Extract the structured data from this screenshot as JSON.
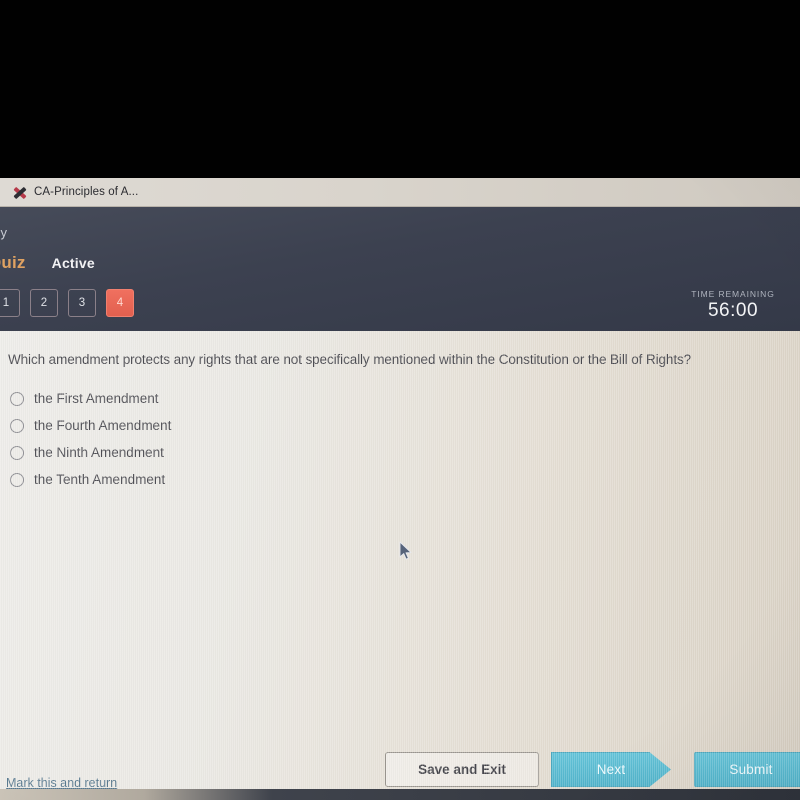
{
  "browser": {
    "tab": {
      "favicon": "x-mark-icon",
      "title": "CA-Principles of A..."
    }
  },
  "header": {
    "breadcrumb_clipped": "cy",
    "quiz_label": "Quiz",
    "status_label": "Active",
    "question_nav": [
      {
        "label": "1",
        "active": false
      },
      {
        "label": "2",
        "active": false
      },
      {
        "label": "3",
        "active": false
      },
      {
        "label": "4",
        "active": true
      }
    ],
    "timer": {
      "label": "TIME REMAINING",
      "value": "56:00"
    },
    "colors": {
      "header_bg": "#3c4150",
      "quiz_accent": "#e0a262",
      "active_tab": "#e2604f"
    }
  },
  "main": {
    "question": "Which amendment protects any rights that are not specifically mentioned within the Constitution or the Bill of Rights?",
    "options": [
      {
        "label": "the First Amendment",
        "selected": false
      },
      {
        "label": "the Fourth Amendment",
        "selected": false
      },
      {
        "label": "the Ninth Amendment",
        "selected": false
      },
      {
        "label": "the Tenth Amendment",
        "selected": false
      }
    ]
  },
  "footer": {
    "mark_return_label": "Mark this and return",
    "save_label": "Save and Exit",
    "next_label": "Next",
    "submit_label": "Submit",
    "colors": {
      "primary_button": "#51b4cb",
      "link": "#58798f"
    }
  }
}
